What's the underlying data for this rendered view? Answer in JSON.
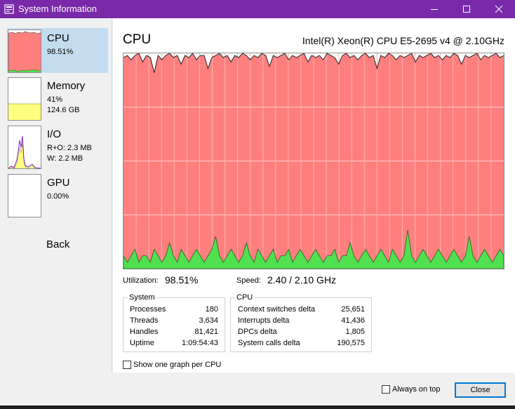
{
  "window": {
    "title": "System Information"
  },
  "sidebar": {
    "items": [
      {
        "title": "CPU",
        "lines": [
          "98.51%"
        ],
        "selected": true,
        "graph_fill": 0.96,
        "color": "#ff7f7f"
      },
      {
        "title": "Memory",
        "lines": [
          "41%",
          "124.6 GB"
        ],
        "selected": false,
        "graph_fill": 0.41,
        "color": "#ffff80"
      },
      {
        "title": "I/O",
        "lines": [
          "R+O: 2.3 MB",
          "W: 2.2 MB"
        ],
        "selected": false,
        "color": "#ffff80"
      },
      {
        "title": "GPU",
        "lines": [
          "0.00%"
        ],
        "selected": false,
        "graph_fill": 0.0,
        "color": "#40c040"
      }
    ],
    "back_label": "Back"
  },
  "main": {
    "title": "CPU",
    "cpu_model": "Intel(R) Xeon(R) CPU E5-2695 v4 @ 2.10GHz",
    "utilization_label": "Utilization:",
    "utilization_value": "98.51%",
    "speed_label": "Speed:",
    "speed_value": "2.40 / 2.10 GHz",
    "system_group": {
      "title": "System",
      "rows": [
        {
          "label": "Processes",
          "value": "180"
        },
        {
          "label": "Threads",
          "value": "3,634"
        },
        {
          "label": "Handles",
          "value": "81,421"
        },
        {
          "label": "Uptime",
          "value": "1:09:54:43"
        }
      ]
    },
    "cpu_group": {
      "title": "CPU",
      "rows": [
        {
          "label": "Context switches delta",
          "value": "25,651"
        },
        {
          "label": "Interrupts delta",
          "value": "41,436"
        },
        {
          "label": "DPCs delta",
          "value": "1,805"
        },
        {
          "label": "System calls delta",
          "value": "190,575"
        }
      ]
    },
    "show_one_graph_label": "Show one graph per CPU",
    "show_one_graph_checked": false
  },
  "footer": {
    "always_on_top_label": "Always on top",
    "always_on_top_checked": false,
    "close_label": "Close"
  },
  "colors": {
    "titlebar": "#7a2aa8",
    "cpu_total": "#ff7f7f",
    "cpu_kernel": "#50e050",
    "selection": "#c4dcf0"
  },
  "chart_data": {
    "type": "area",
    "title": "CPU",
    "series": [
      {
        "name": "",
        "values": [
          98,
          99,
          97,
          99,
          100,
          96,
          99,
          98,
          91,
          99,
          97,
          99,
          100,
          98,
          99,
          95,
          99,
          98,
          100,
          97,
          99,
          99,
          93,
          98,
          99,
          100,
          98,
          99,
          96,
          99,
          98,
          100,
          99,
          97,
          99,
          98,
          100,
          99,
          94,
          99,
          98,
          99,
          100,
          97,
          99,
          98,
          99,
          100,
          96,
          99,
          98,
          99,
          97,
          100,
          99,
          98,
          95,
          99,
          100,
          98,
          99,
          97,
          99,
          100,
          98,
          99,
          93,
          99,
          98,
          100,
          99,
          97,
          99,
          98,
          99,
          100,
          96,
          99,
          98,
          99,
          100,
          98,
          99,
          97,
          99,
          98,
          100,
          99,
          95,
          99,
          98,
          99,
          100,
          97,
          99,
          98,
          99,
          100,
          98,
          99
        ]
      },
      {
        "name": "",
        "values": [
          2,
          1,
          2,
          3,
          1,
          2,
          2,
          1,
          3,
          2,
          1,
          2,
          4,
          2,
          1,
          3,
          2,
          1,
          2,
          3,
          2,
          1,
          2,
          3,
          5,
          2,
          1,
          2,
          3,
          2,
          1,
          2,
          4,
          2,
          1,
          3,
          2,
          1,
          2,
          3,
          1,
          2,
          2,
          3,
          1,
          2,
          3,
          2,
          1,
          2,
          3,
          2,
          1,
          2,
          2,
          3,
          1,
          2,
          2,
          4,
          2,
          1,
          2,
          3,
          2,
          1,
          2,
          3,
          2,
          1,
          3,
          2,
          1,
          2,
          6,
          2,
          1,
          2,
          3,
          2,
          1,
          2,
          3,
          2,
          1,
          2,
          3,
          2,
          1,
          2,
          5,
          2,
          1,
          2,
          3,
          2,
          1,
          2,
          3,
          2
        ]
      }
    ],
    "ylim": [
      0,
      100
    ],
    "grid": true
  }
}
